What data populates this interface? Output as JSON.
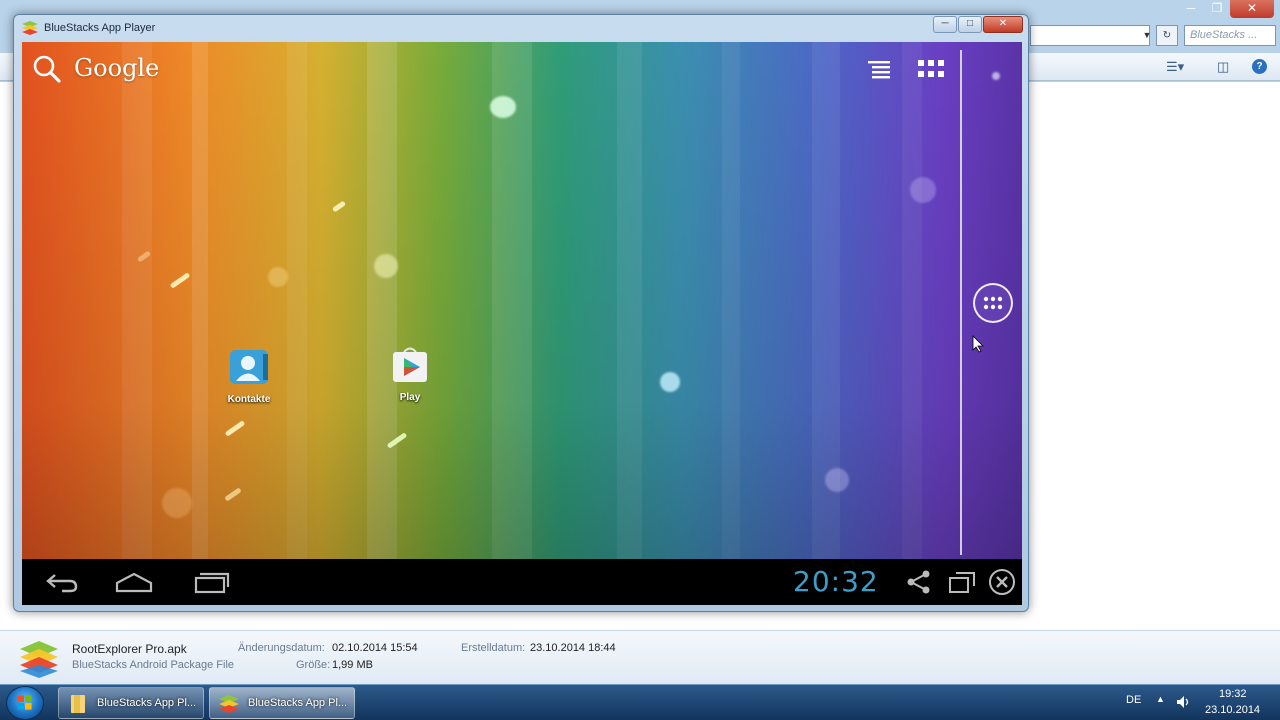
{
  "explorer": {
    "search_placeholder": "BlueStacks ...",
    "toolbar": {
      "view_icon": "view-options-icon",
      "preview_icon": "preview-pane-icon",
      "help_icon": "help-icon"
    },
    "details": {
      "file_name": "RootExplorer Pro.apk",
      "file_type": "BlueStacks Android Package File",
      "modified_label": "Änderungsdatum:",
      "modified_value": "02.10.2014 15:54",
      "size_label": "Größe:",
      "size_value": "1,99 MB",
      "created_label": "Erstelldatum:",
      "created_value": "23.10.2014 18:44"
    }
  },
  "bluestacks": {
    "title": "BlueStacks App Player",
    "google_label": "Google",
    "desktop_icons": [
      {
        "label": "Kontakte",
        "icon": "contacts-icon"
      },
      {
        "label": "Play",
        "icon": "play-store-icon"
      }
    ],
    "clock": "20:32"
  },
  "taskbar": {
    "buttons": [
      {
        "label": "BlueStacks App Pl...",
        "icon": "folder-icon"
      },
      {
        "label": "BlueStacks App Pl...",
        "icon": "bluestacks-icon"
      }
    ],
    "language": "DE",
    "time": "19:32",
    "date": "23.10.2014"
  },
  "colors": {
    "clock": "#3c9fca",
    "taskbar": "#1d4f7a",
    "window_frame": "#b9d3ea"
  }
}
